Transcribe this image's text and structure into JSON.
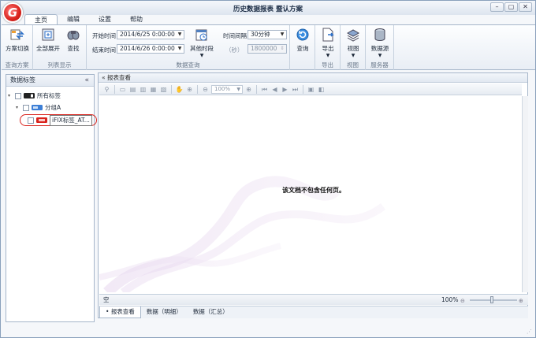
{
  "window": {
    "title": "历史数据报表 暨认方案",
    "logo_letter": "G",
    "controls": [
      "–",
      "▢",
      "✕"
    ]
  },
  "menu_tabs": [
    {
      "label": "主页",
      "active": true
    },
    {
      "label": "编辑",
      "active": false
    },
    {
      "label": "设置",
      "active": false
    },
    {
      "label": "帮助",
      "active": false
    }
  ],
  "ribbon": {
    "query_scheme": {
      "group_label": "查询方案",
      "switch_button": "方案切换"
    },
    "list_display": {
      "group_label": "列表显示",
      "expand_all": "全部展开",
      "find": "查找"
    },
    "data_query": {
      "group_label": "数据查询",
      "start_label": "开始时间",
      "start_value": "2014/6/25 0:00:00",
      "end_label": "结束时间",
      "end_value": "2014/6/26 0:00:00",
      "other_period": "其他时段",
      "interval_label": "时间间隔",
      "interval_value": "30分钟",
      "seconds_label": "（秒）",
      "seconds_value": "1800000"
    },
    "query_button": "查询",
    "export": {
      "group_label": "导出",
      "button": "导出"
    },
    "view": {
      "group_label": "视图",
      "button": "视图"
    },
    "server": {
      "group_label": "服务器",
      "button": "数据源"
    }
  },
  "left_panel": {
    "title": "数据标签",
    "collapse_glyph": "«",
    "tree": [
      {
        "label": "所有标签",
        "level": 0
      },
      {
        "label": "分组A",
        "level": 1
      },
      {
        "label": "iFIX标签_AT...",
        "level": 2
      }
    ]
  },
  "report_panel": {
    "title": "报表查看",
    "zoom_box": "100%",
    "empty_message": "该文档不包含任何页。",
    "status_left": "空",
    "status_zoom": "100%"
  },
  "bottom_tabs": [
    {
      "label": "报表查看",
      "active": true
    },
    {
      "label": "数据（明细）",
      "active": false
    },
    {
      "label": "数据（汇总）",
      "active": false
    }
  ],
  "colors": {
    "accent": "#d9231d",
    "border": "#a6b6ca"
  }
}
